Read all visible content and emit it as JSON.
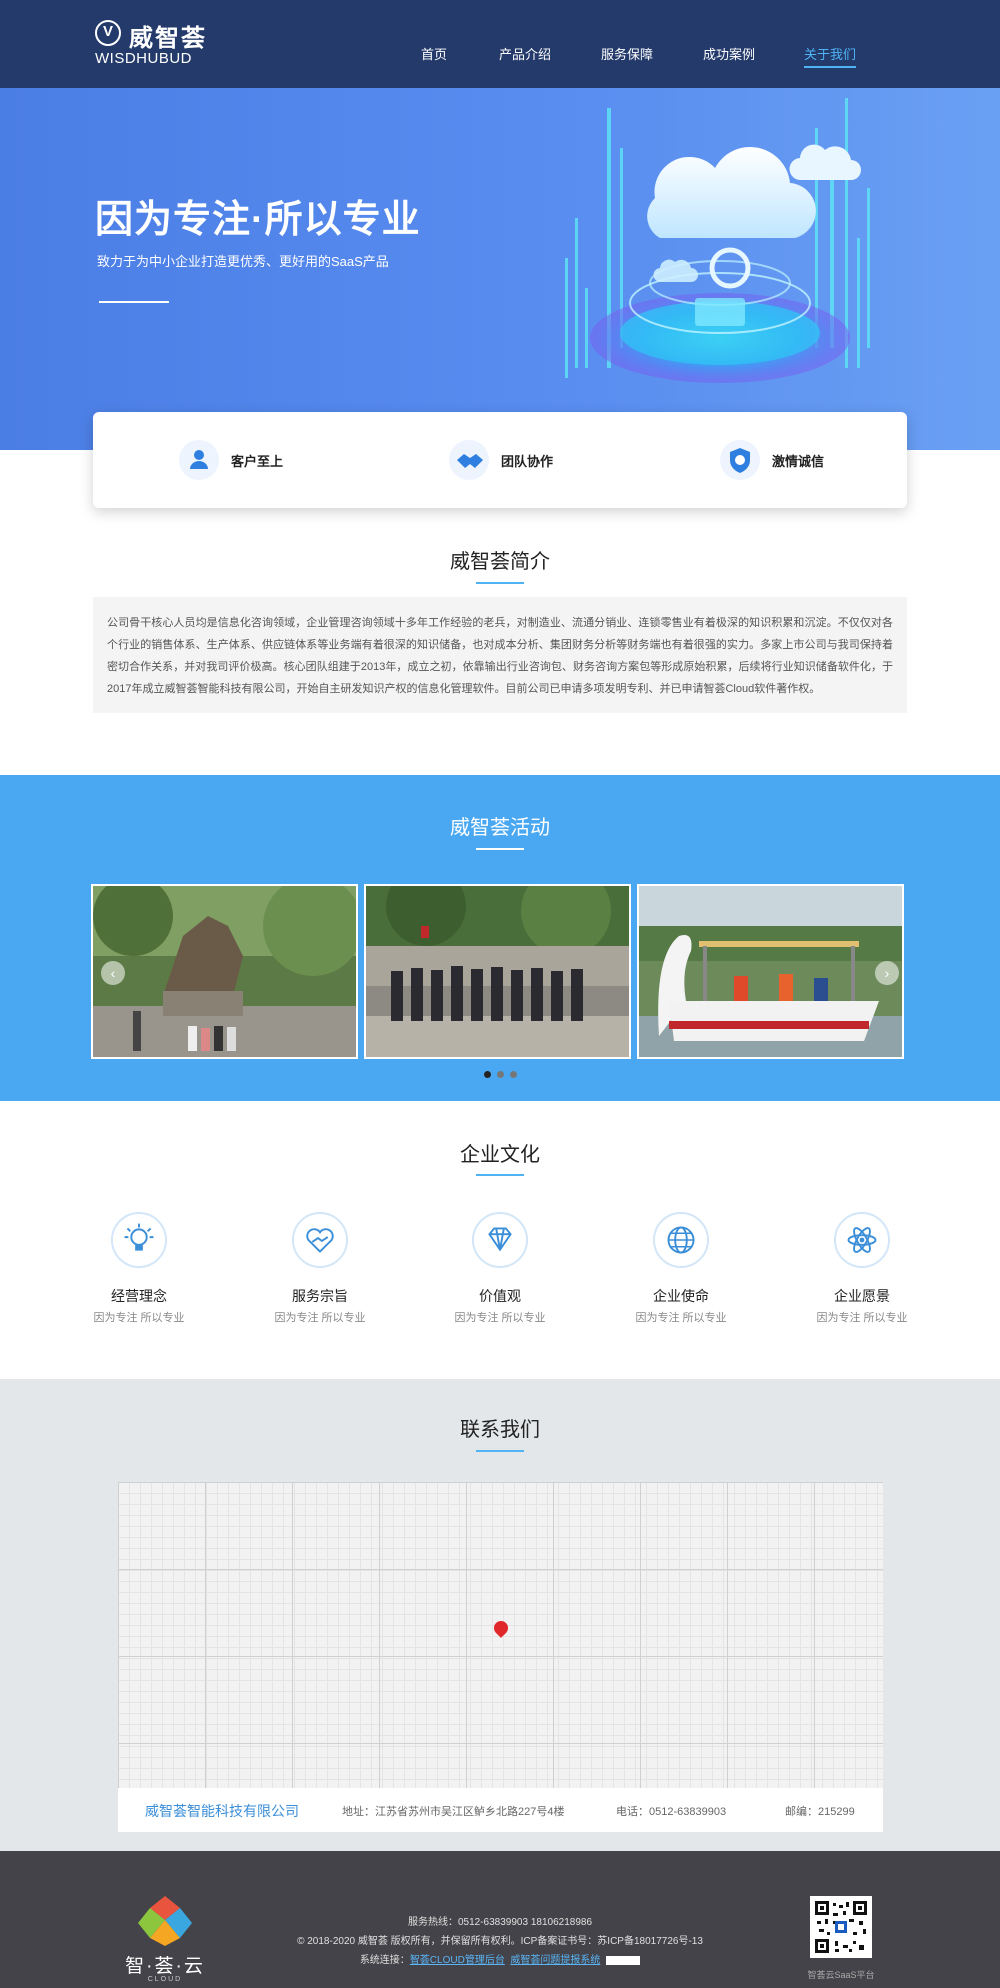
{
  "header": {
    "logo_cn": "威智荟",
    "logo_en": "WISDHUBUD",
    "nav": [
      "首页",
      "产品介绍",
      "服务保障",
      "成功案例",
      "关于我们"
    ]
  },
  "hero": {
    "title": "因为专注·所以专业",
    "subtitle": "致力于为中小企业打造更优秀、更好用的SaaS产品"
  },
  "values": [
    {
      "label": "客户至上",
      "icon": "customer-icon"
    },
    {
      "label": "团队协作",
      "icon": "handshake-icon"
    },
    {
      "label": "激情诚信",
      "icon": "shield-icon"
    }
  ],
  "intro": {
    "title": "威智荟简介",
    "text": "公司骨干核心人员均是信息化咨询领域，企业管理咨询领域十多年工作经验的老兵，对制造业、流通分销业、连锁零售业有着极深的知识积累和沉淀。不仅仅对各个行业的销售体系、生产体系、供应链体系等业务端有着很深的知识储备，也对成本分析、集团财务分析等财务端也有着很强的实力。多家上市公司与我司保持着密切合作关系，并对我司评价极高。核心团队组建于2013年，成立之初，依靠输出行业咨询包、财务咨询方案包等形成原始积累，后续将行业知识储备软件化，于2017年成立威智荟智能科技有限公司，开始自主研发知识产权的信息化管理软件。目前公司已申请多项发明专利、并已申请智荟Cloud软件著作权。"
  },
  "activity": {
    "title": "威智荟活动",
    "photos": [
      "statue-group-photo",
      "team-group-photo",
      "swan-boat-photo"
    ],
    "prev_arrow": "‹",
    "next_arrow": "›"
  },
  "culture": {
    "title": "企业文化",
    "items": [
      {
        "name": "经营理念",
        "desc": "因为专注 所以专业",
        "icon": "lightbulb-icon"
      },
      {
        "name": "服务宗旨",
        "desc": "因为专注 所以专业",
        "icon": "heart-hands-icon"
      },
      {
        "name": "价值观",
        "desc": "因为专注 所以专业",
        "icon": "diamond-icon"
      },
      {
        "name": "企业使命",
        "desc": "因为专注 所以专业",
        "icon": "globe-icon"
      },
      {
        "name": "企业愿景",
        "desc": "因为专注 所以专业",
        "icon": "atom-icon"
      }
    ]
  },
  "contact": {
    "title": "联系我们",
    "company": "威智荟智能科技有限公司",
    "address": "地址：江苏省苏州市吴江区鲈乡北路227号4楼",
    "phone": "电话：0512-63839903",
    "postcode": "邮编：215299"
  },
  "footer": {
    "brand": "智·荟·云",
    "brand_en": "CLOUD",
    "hotline": "服务热线：0512-63839903 18106218986",
    "copyright": "© 2018-2020 威智荟 版权所有，并保留所有权利。ICP备案证书号：苏ICP备18017726号-13",
    "links_label": "系统连接：",
    "link1": "智荟CLOUD管理后台",
    "link2": "威智荟问题提报系统",
    "qr_caption": "智荟云SaaS平台"
  },
  "colors": {
    "header_bg": "#233a6b",
    "hero_bg": "#5a8ef0",
    "accent": "#4fb3f4",
    "activity_bg": "#4aa8f2",
    "footer_bg": "#434349"
  }
}
